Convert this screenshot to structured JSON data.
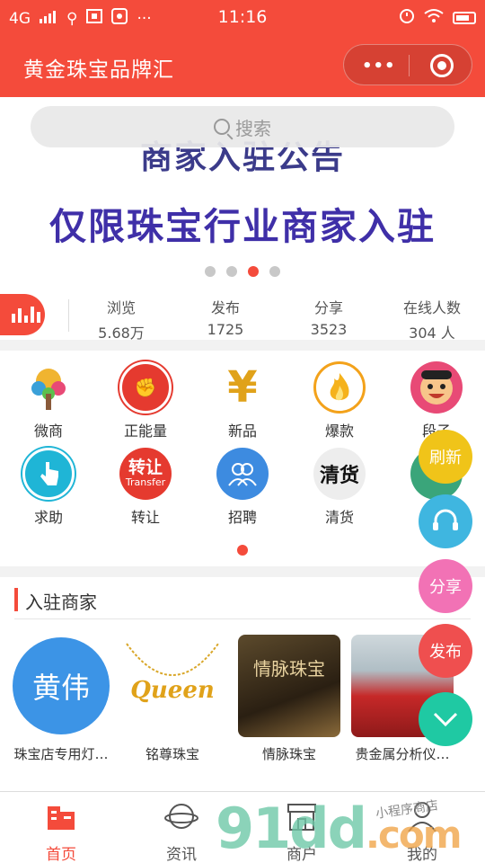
{
  "status": {
    "network": "4G",
    "time": "11:16"
  },
  "header": {
    "title": "黄金珠宝品牌汇"
  },
  "banner": {
    "headline_sub": "商家入驻公告",
    "headline_main": "仅限珠宝行业商家入驻",
    "search_placeholder": "搜索",
    "slide_count": 4,
    "active_slide": 3
  },
  "stats": [
    {
      "label": "浏览",
      "value": "5.68万"
    },
    {
      "label": "发布",
      "value": "1725"
    },
    {
      "label": "分享",
      "value": "3523"
    },
    {
      "label": "在线人数",
      "value": "304 人"
    }
  ],
  "categories": [
    {
      "label": "微商",
      "icon": "colorful-tree-icon",
      "color": "#3aa0d8"
    },
    {
      "label": "正能量",
      "icon": "raised-fist-icon",
      "color": "#e53a2f"
    },
    {
      "label": "新品",
      "icon": "yen-icon",
      "color": "#e0a21a"
    },
    {
      "label": "爆款",
      "icon": "flame-icon",
      "color": "#f3a21b"
    },
    {
      "label": "段子",
      "icon": "laughing-face-icon",
      "color": "#e84a76"
    },
    {
      "label": "求助",
      "icon": "touch-hand-icon",
      "color": "#1fb5d6"
    },
    {
      "label": "转让",
      "icon": "transfer-icon",
      "color": "#e53a2f",
      "text": "转让",
      "subtext": "Transfer"
    },
    {
      "label": "招聘",
      "icon": "people-icon",
      "color": "#3d8be0"
    },
    {
      "label": "清货",
      "icon": "calligraphy-clearance-icon",
      "color": "#ededed",
      "text": "清货"
    }
  ],
  "merchants_section": {
    "title": "入驻商家",
    "items": [
      {
        "name": "珠宝店专用灯…",
        "logo_text": "黄伟"
      },
      {
        "name": "铭尊珠宝",
        "logo_text": "Queen"
      },
      {
        "name": "情脉珠宝",
        "logo_text": "情脉珠宝"
      },
      {
        "name": "贵金属分析仪…"
      }
    ]
  },
  "floating": {
    "refresh": "刷新",
    "share": "分享",
    "publish": "发布"
  },
  "tabs": [
    {
      "label": "首页",
      "active": true
    },
    {
      "label": "资讯"
    },
    {
      "label": "商户"
    },
    {
      "label": "我的"
    }
  ],
  "watermark": {
    "main": "91dd",
    "suffix": ".com",
    "small": "小程序商店"
  }
}
